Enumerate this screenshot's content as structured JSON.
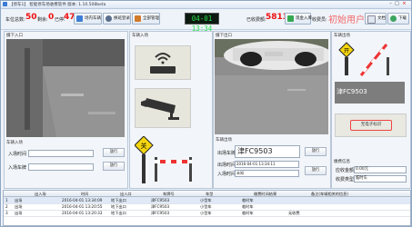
{
  "titlebar": {
    "title": "【停车1】 智能停车场收费软件 版本: 1.10.508beta",
    "min": "–",
    "max": "□",
    "close": "×"
  },
  "toolbar": {
    "spaces_label": "车位总数:",
    "spaces_value": "50",
    "free_label": "剩余:",
    "free_value": "0",
    "parked_label": "已停:",
    "parked_value": "47",
    "btn_lot": "场内车辆",
    "btn_shift": "换班登录",
    "btn_manage": "全部管理",
    "clock": "04-01 13:34",
    "revenue_label": "已收费额:",
    "revenue_value": "5813.0",
    "btn_in_record": "现金入库",
    "operator_label": "收费员:",
    "operator_value": "初始用户",
    "btn_text": "文档",
    "btn_download": "下载"
  },
  "left": {
    "cam_title": "摄下入口",
    "section_title": "车辆入场",
    "row1_label": "入场时间",
    "row1_btn": "放行",
    "row2_label": "入场车牌",
    "row2_btn": "放行"
  },
  "signs_left": {
    "title": "车辆入场"
  },
  "mid_cam": {
    "title": "摄下出口"
  },
  "out_panel": {
    "title": "车辆出场",
    "plate_label": "出场车牌",
    "plate_value": "津FC9503",
    "time_label": "出场时间",
    "time_value": "2016-04-01 13:34:11",
    "entry_label": "入场时间",
    "entry_value": "未知",
    "btn1": "放行",
    "btn2": "放行"
  },
  "right": {
    "title": "车辆出场",
    "plate_text": "津FC9503",
    "ticket_text": "无电子标识",
    "info_title": "缴费信息",
    "fee_label": "应收金额",
    "fee_value": "0.00元",
    "type_label": "收费类型",
    "type_value": "临时车"
  },
  "table": {
    "headers": [
      "",
      "出入场",
      "时间",
      "出入口",
      "车牌号",
      "车型",
      "缴费时间结果",
      "备注(车辆相关的信息)"
    ],
    "rows": [
      [
        "1",
        "出场",
        "2016-04-01 13:34:09",
        "地下出口",
        "津FC9503",
        "小型车",
        "临时车",
        ""
      ],
      [
        "2",
        "出场",
        "2016-04-01 13:20:55",
        "地下出口",
        "津FC9503",
        "小型车",
        "临时车",
        ""
      ],
      [
        "3",
        "出场",
        "2016-04-01 13:20:33",
        "地下出口",
        "津FC9503",
        "小型车",
        "临时车",
        "无收费"
      ]
    ]
  },
  "colors": {
    "accent": "#e11111",
    "lcd_bg": "#0c1a10",
    "lcd_fg": "#25e04a",
    "panel": "#f2f5f9"
  }
}
